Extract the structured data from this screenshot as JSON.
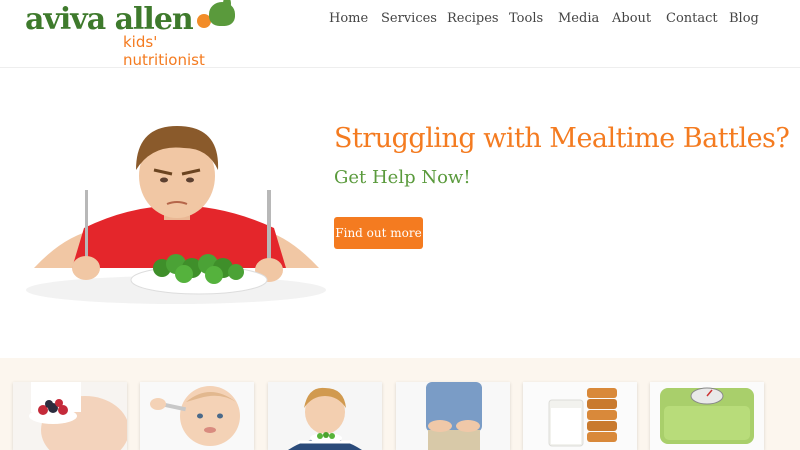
{
  "logo": {
    "main": "aviva allen",
    "sub": "kids' nutritionist"
  },
  "nav": [
    "Home",
    "Services",
    "Recipes",
    "Tools",
    "Media",
    "About",
    "Contact",
    "Blog"
  ],
  "hero": {
    "headline": "Struggling with Mealtime Battles?",
    "subhead": "Get Help Now!",
    "cta": "Find out more"
  },
  "colors": {
    "brand_green": "#3e7a2c",
    "accent_orange": "#f47b20",
    "band_bg": "#fcf6ee"
  }
}
